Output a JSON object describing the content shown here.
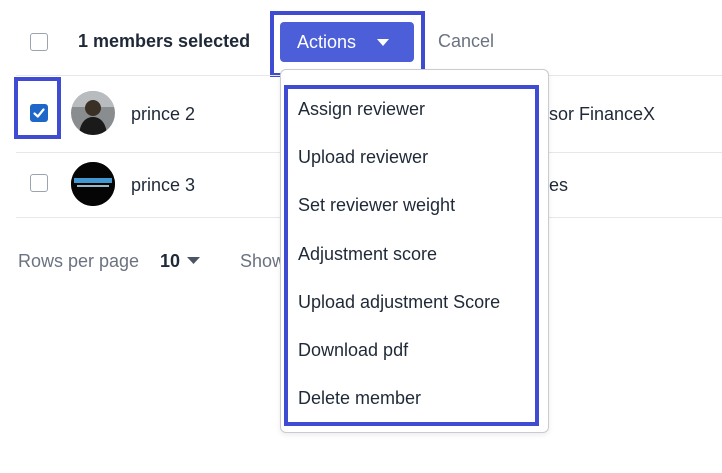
{
  "header": {
    "selected_label": "1 members selected",
    "actions_label": "Actions",
    "cancel_label": "Cancel"
  },
  "rows": [
    {
      "name": "prince 2",
      "checked": true,
      "trailing_text": "sor FinanceX"
    },
    {
      "name": "prince 3",
      "checked": false,
      "trailing_text": "es"
    }
  ],
  "footer": {
    "rows_per_page_label": "Rows per page",
    "rows_per_page_value": "10",
    "showing_text": "Show"
  },
  "actions_menu": {
    "items": [
      "Assign reviewer",
      "Upload reviewer",
      "Set reviewer weight",
      "Adjustment score",
      "Upload adjustment Score",
      "Download pdf",
      "Delete member"
    ]
  },
  "colors": {
    "primary": "#4c5fd8",
    "highlight": "#3f4bd1",
    "checkbox_checked": "#1f66c9"
  }
}
